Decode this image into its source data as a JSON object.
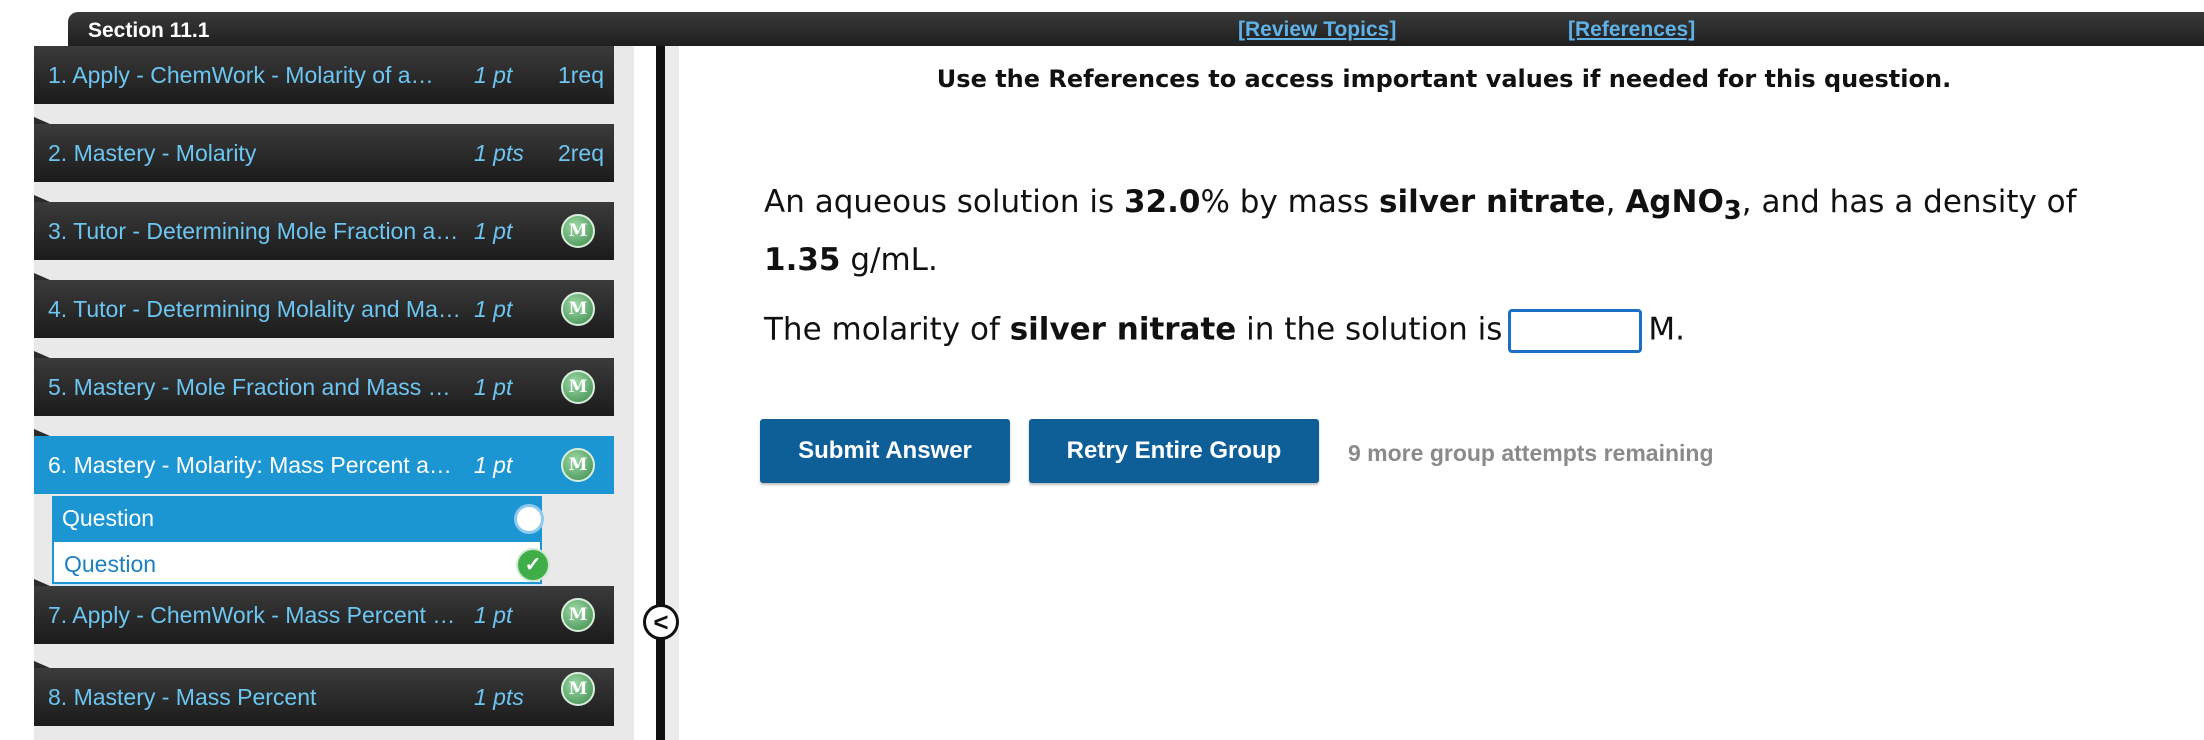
{
  "header": {
    "section_title": "Section 11.1",
    "review_topics": "[Review Topics]",
    "references": "[References]"
  },
  "sidebar": {
    "items": [
      {
        "title": "1. Apply - ChemWork - Molarity of a…",
        "pts": "1 pt",
        "req": "1req"
      },
      {
        "title": "2. Mastery - Molarity",
        "pts": "1 pts",
        "req": "2req"
      },
      {
        "title": "3. Tutor - Determining Mole Fraction a…",
        "pts": "1 pt",
        "badge": "M"
      },
      {
        "title": "4. Tutor - Determining Molality and Ma…",
        "pts": "1 pt",
        "badge": "M"
      },
      {
        "title": "5. Mastery - Mole Fraction and Mass …",
        "pts": "1 pt",
        "badge": "M"
      },
      {
        "title": "6. Mastery - Molarity: Mass Percent a…",
        "pts": "1 pt",
        "badge": "M"
      },
      {
        "title": "7. Apply - ChemWork - Mass Percent …",
        "pts": "1 pt",
        "badge": "M"
      },
      {
        "title": "8. Mastery - Mass Percent",
        "pts": "1 pts",
        "badge": "M"
      }
    ],
    "subitems": [
      {
        "label": "Question"
      },
      {
        "label": "Question"
      }
    ]
  },
  "collapse_glyph": "<",
  "content": {
    "notice": "Use the References to access important values if needed for this question.",
    "q1": {
      "p1": "An aqueous solution is ",
      "pct": "32.0",
      "p2": "% by mass ",
      "substance": "silver nitrate",
      "p3": ", ",
      "formula_base": "AgNO",
      "formula_sub": "3",
      "p4": ", and has a density of",
      "density": "1.35",
      "unit": " g/mL."
    },
    "q2": {
      "p1": "The molarity of ",
      "substance": "silver nitrate",
      "p2": " in the solution is",
      "unit": "M."
    },
    "buttons": {
      "submit": "Submit Answer",
      "retry": "Retry Entire Group"
    },
    "attempts": "9 more group attempts remaining"
  },
  "colors": {
    "accent": "#1b96d3",
    "button": "#0e5f98",
    "link": "#5fb2e8",
    "badge_green": "#3fae49"
  }
}
